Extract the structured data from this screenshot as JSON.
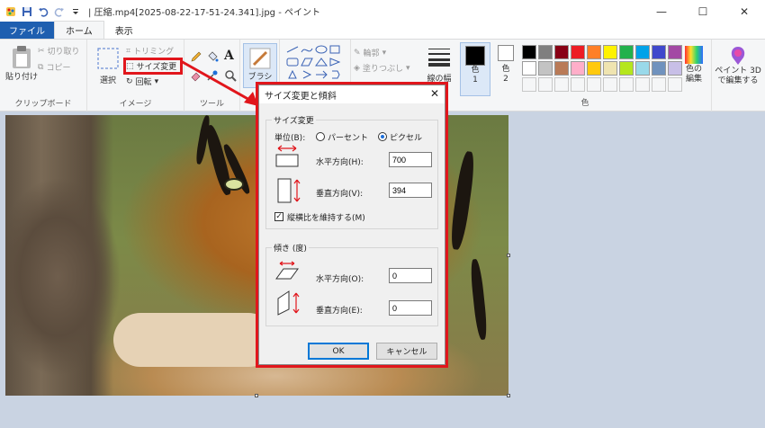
{
  "window": {
    "title": "| 圧縮.mp4[2025-08-22-17-51-24.341].jpg - ペイント",
    "minimize": "—",
    "maximize": "☐",
    "close": "✕"
  },
  "tabs": [
    {
      "label": "ファイル"
    },
    {
      "label": "ホーム"
    },
    {
      "label": "表示"
    }
  ],
  "ribbon": {
    "clipboard": {
      "paste": "貼り付け",
      "cut": "切り取り",
      "copy": "コピー",
      "label": "クリップボード"
    },
    "image": {
      "select": "選択",
      "crop": "トリミング",
      "resize": "サイズ変更",
      "rotate": "回転",
      "label": "イメージ"
    },
    "tools": {
      "label": "ツール",
      "text_tool": "A"
    },
    "brushes": {
      "label": "ブラシ"
    },
    "shapes": {
      "outline": "輪郭",
      "fill": "塗りつぶし"
    },
    "size": {
      "label": "線の幅"
    },
    "colors": {
      "color1": "色\n1",
      "color2": "色\n2",
      "edit": "色の\n編集",
      "label": "色",
      "row1": [
        "#000000",
        "#7f7f7f",
        "#880015",
        "#ed1c24",
        "#ff7f27",
        "#fff200",
        "#22b14c",
        "#00a2e8",
        "#3f48cc",
        "#a349a4"
      ],
      "row2": [
        "#ffffff",
        "#c3c3c3",
        "#b97a57",
        "#ffaec9",
        "#ffc90e",
        "#efe4b0",
        "#b5e61d",
        "#99d9ea",
        "#7092be",
        "#c8bfe7"
      ]
    },
    "paint3d": "ペイント 3D\nで編集する"
  },
  "dialog": {
    "title": "サイズ変更と傾斜",
    "close": "✕",
    "resize": {
      "legend": "サイズ変更",
      "unit_label": "単位(B):",
      "percent": "パーセント",
      "pixel": "ピクセル",
      "horizontal_label": "水平方向(H):",
      "horizontal_value": "700",
      "vertical_label": "垂直方向(V):",
      "vertical_value": "394",
      "keep_ratio": "縦横比を維持する(M)"
    },
    "skew": {
      "legend": "傾き (度)",
      "horizontal_label": "水平方向(O):",
      "horizontal_value": "0",
      "vertical_label": "垂直方向(E):",
      "vertical_value": "0"
    },
    "ok": "OK",
    "cancel": "キャンセル"
  },
  "accent": {
    "highlight": "#e1161c",
    "file_tab": "#1e5fb0"
  }
}
